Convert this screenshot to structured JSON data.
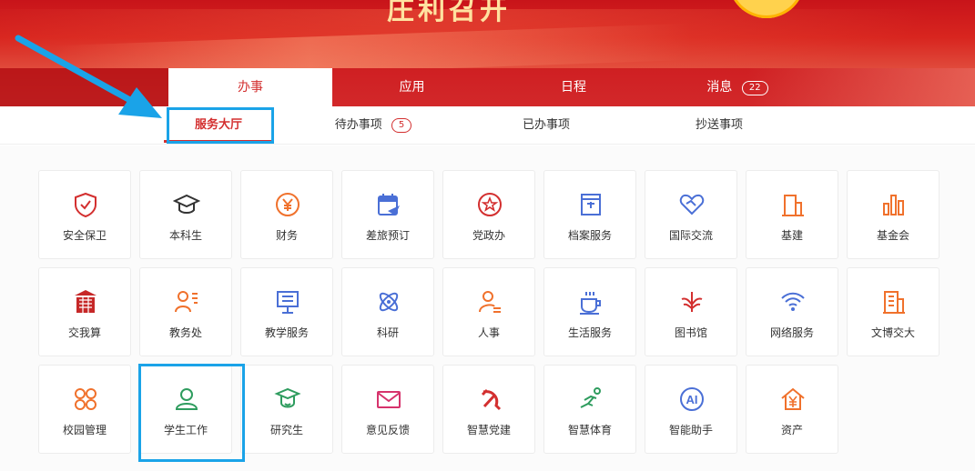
{
  "banner": {
    "title": "庄利召开"
  },
  "main_tabs": [
    {
      "label": "办事",
      "badge": ""
    },
    {
      "label": "应用",
      "badge": ""
    },
    {
      "label": "日程",
      "badge": ""
    },
    {
      "label": "消息",
      "badge": "22"
    }
  ],
  "sub_tabs": [
    {
      "label": "服务大厅",
      "badge": ""
    },
    {
      "label": "待办事项",
      "badge": "5"
    },
    {
      "label": "已办事项",
      "badge": ""
    },
    {
      "label": "抄送事项",
      "badge": ""
    }
  ],
  "services": [
    {
      "label": "安全保卫",
      "icon": "shield-check-icon",
      "color": "#d32f2f"
    },
    {
      "label": "本科生",
      "icon": "graduation-cap-icon",
      "color": "#333333"
    },
    {
      "label": "财务",
      "icon": "yen-coin-icon",
      "color": "#f0712c"
    },
    {
      "label": "差旅预订",
      "icon": "calendar-plane-icon",
      "color": "#4a6fd6"
    },
    {
      "label": "党政办",
      "icon": "star-circle-icon",
      "color": "#d32f2f"
    },
    {
      "label": "档案服务",
      "icon": "archive-box-icon",
      "color": "#4a6fd6"
    },
    {
      "label": "国际交流",
      "icon": "handshake-heart-icon",
      "color": "#4a6fd6"
    },
    {
      "label": "基建",
      "icon": "building-icon",
      "color": "#f0712c"
    },
    {
      "label": "基金会",
      "icon": "bar-chart-icon",
      "color": "#f0712c"
    },
    {
      "label": "交我算",
      "icon": "server-icon",
      "color": "#c62828"
    },
    {
      "label": "教务处",
      "icon": "person-list-icon",
      "color": "#f0712c"
    },
    {
      "label": "教学服务",
      "icon": "presentation-board-icon",
      "color": "#4a6fd6"
    },
    {
      "label": "科研",
      "icon": "atom-icon",
      "color": "#4a6fd6"
    },
    {
      "label": "人事",
      "icon": "person-doc-icon",
      "color": "#f0712c"
    },
    {
      "label": "生活服务",
      "icon": "coffee-cup-icon",
      "color": "#4a6fd6"
    },
    {
      "label": "图书馆",
      "icon": "library-emblem-icon",
      "color": "#d32f2f"
    },
    {
      "label": "网络服务",
      "icon": "wifi-icon",
      "color": "#4a6fd6"
    },
    {
      "label": "文博交大",
      "icon": "museum-icon",
      "color": "#f0712c"
    },
    {
      "label": "校园管理",
      "icon": "four-rings-icon",
      "color": "#f0712c"
    },
    {
      "label": "学生工作",
      "icon": "student-icon",
      "color": "#2e9c5e"
    },
    {
      "label": "研究生",
      "icon": "grad-cap-face-icon",
      "color": "#2e9c5e"
    },
    {
      "label": "意见反馈",
      "icon": "envelope-icon",
      "color": "#d6336c"
    },
    {
      "label": "智慧党建",
      "icon": "hammer-sickle-icon",
      "color": "#d32f2f"
    },
    {
      "label": "智慧体育",
      "icon": "runner-icon",
      "color": "#2e9c5e"
    },
    {
      "label": "智能助手",
      "icon": "ai-circle-icon",
      "color": "#4a6fd6"
    },
    {
      "label": "资产",
      "icon": "house-yen-icon",
      "color": "#f0712c"
    }
  ]
}
